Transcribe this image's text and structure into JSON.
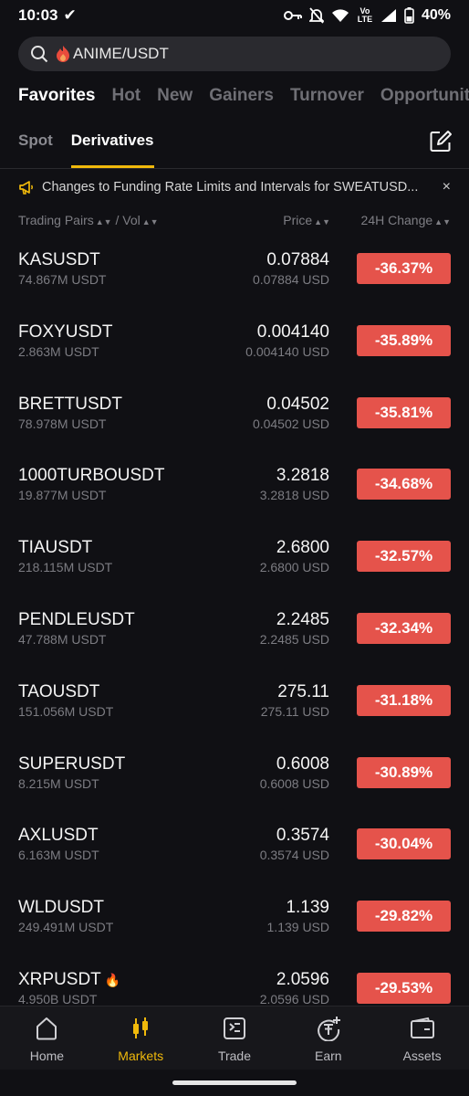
{
  "status_bar": {
    "time": "10:03",
    "battery": "40%",
    "network": "Vo LTE"
  },
  "search": {
    "value": "ANIME/USDT",
    "icons": [
      "search-icon",
      "fire-icon"
    ]
  },
  "top_tabs": [
    {
      "label": "Favorites",
      "active": true
    },
    {
      "label": "Hot",
      "active": false
    },
    {
      "label": "New",
      "active": false
    },
    {
      "label": "Gainers",
      "active": false
    },
    {
      "label": "Turnover",
      "active": false
    },
    {
      "label": "Opportuniti",
      "active": false
    }
  ],
  "sub_tabs": [
    {
      "label": "Spot",
      "active": false
    },
    {
      "label": "Derivatives",
      "active": true
    }
  ],
  "notice": {
    "text": "Changes to Funding  Rate Limits and Intervals for SWEATUSD...",
    "close": "×"
  },
  "columns": {
    "pairs": "Trading Pairs",
    "vol": "/ Vol",
    "price": "Price",
    "change": "24H Change"
  },
  "rows": [
    {
      "pair": "KASUSDT",
      "vol": "74.867M USDT",
      "price": "0.07884",
      "price_usd": "0.07884 USD",
      "change": "-36.37%"
    },
    {
      "pair": "FOXYUSDT",
      "vol": "2.863M USDT",
      "price": "0.004140",
      "price_usd": "0.004140 USD",
      "change": "-35.89%"
    },
    {
      "pair": "BRETTUSDT",
      "vol": "78.978M USDT",
      "price": "0.04502",
      "price_usd": "0.04502 USD",
      "change": "-35.81%"
    },
    {
      "pair": "1000TURBOUSDT",
      "vol": "19.877M USDT",
      "price": "3.2818",
      "price_usd": "3.2818 USD",
      "change": "-34.68%"
    },
    {
      "pair": "TIAUSDT",
      "vol": "218.115M USDT",
      "price": "2.6800",
      "price_usd": "2.6800 USD",
      "change": "-32.57%"
    },
    {
      "pair": "PENDLEUSDT",
      "vol": "47.788M USDT",
      "price": "2.2485",
      "price_usd": "2.2485 USD",
      "change": "-32.34%"
    },
    {
      "pair": "TAOUSDT",
      "vol": "151.056M USDT",
      "price": "275.11",
      "price_usd": "275.11 USD",
      "change": "-31.18%"
    },
    {
      "pair": "SUPERUSDT",
      "vol": "8.215M USDT",
      "price": "0.6008",
      "price_usd": "0.6008 USD",
      "change": "-30.89%"
    },
    {
      "pair": "AXLUSDT",
      "vol": "6.163M USDT",
      "price": "0.3574",
      "price_usd": "0.3574 USD",
      "change": "-30.04%"
    },
    {
      "pair": "WLDUSDT",
      "vol": "249.491M USDT",
      "price": "1.139",
      "price_usd": "1.139 USD",
      "change": "-29.82%"
    },
    {
      "pair": "XRPUSDT",
      "vol": "4.950B USDT",
      "price": "2.0596",
      "price_usd": "2.0596 USD",
      "change": "-29.53%",
      "hot": true
    }
  ],
  "bottom_nav": [
    {
      "label": "Home",
      "icon": "home-icon",
      "active": false
    },
    {
      "label": "Markets",
      "icon": "markets-icon",
      "active": true
    },
    {
      "label": "Trade",
      "icon": "trade-icon",
      "active": false
    },
    {
      "label": "Earn",
      "icon": "earn-icon",
      "active": false
    },
    {
      "label": "Assets",
      "icon": "wallet-icon",
      "active": false
    }
  ],
  "colors": {
    "accent": "#f0b90b",
    "negative": "#e5534b",
    "background": "#101014"
  }
}
